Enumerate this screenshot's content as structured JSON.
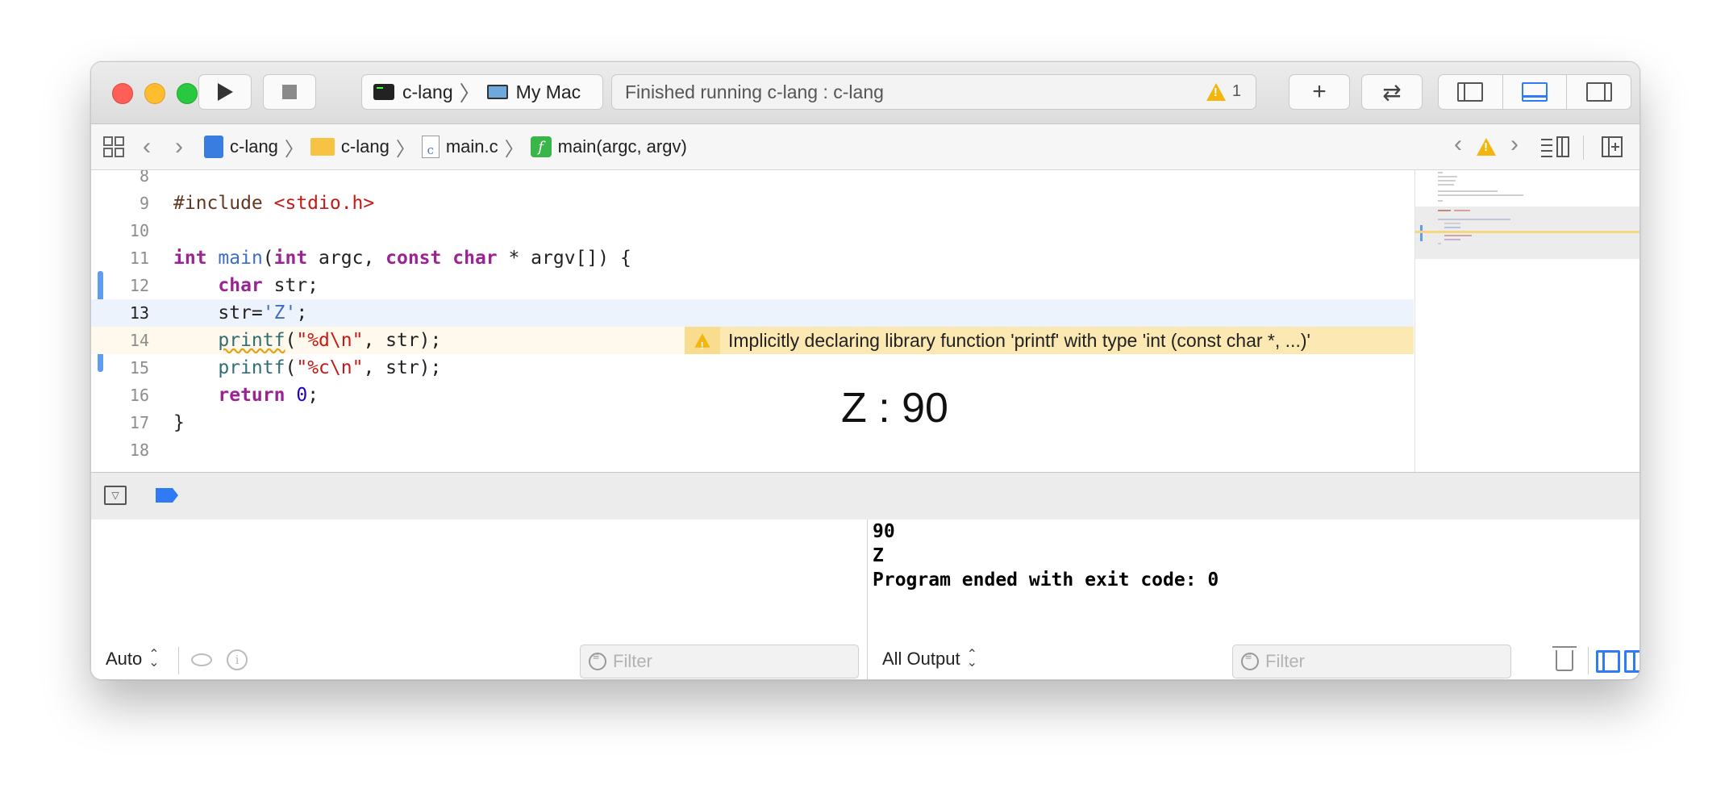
{
  "toolbar": {
    "scheme": "c-lang",
    "destination": "My Mac",
    "activity_status": "Finished running c-lang : c-lang",
    "warning_count": "1",
    "add_label": "+",
    "swap_label": "⇄"
  },
  "jumpbar": {
    "items": [
      "c-lang",
      "c-lang",
      "main.c",
      "main(argc, argv)"
    ]
  },
  "editor": {
    "lines": [
      {
        "num": "8"
      },
      {
        "num": "9"
      },
      {
        "num": "10"
      },
      {
        "num": "11"
      },
      {
        "num": "12"
      },
      {
        "num": "13"
      },
      {
        "num": "14"
      },
      {
        "num": "15"
      },
      {
        "num": "16"
      },
      {
        "num": "17"
      },
      {
        "num": "18"
      }
    ],
    "code": {
      "l9_pre": "#include ",
      "l9_hdr": "<stdio.h>",
      "l11_int": "int",
      "l11_main": "main",
      "l11_a": "(",
      "l11_int2": "int",
      "l11_b": " argc, ",
      "l11_const": "const",
      "l11_sp": " ",
      "l11_char": "char",
      "l11_c": " * argv[]) {",
      "l12_char": "char",
      "l12_rest": " str;",
      "l13_a": "str=",
      "l13_str": "'Z'",
      "l13_b": ";",
      "l14_fn": "printf",
      "l14_a": "(",
      "l14_str": "\"%d\\n\"",
      "l14_b": ", str);",
      "l15_fn": "printf",
      "l15_a": "(",
      "l15_str": "\"%c\\n\"",
      "l15_b": ", str);",
      "l16_ret": "return",
      "l16_sp": " ",
      "l16_num": "0",
      "l16_b": ";",
      "l17": "}"
    },
    "issue_message": "Implicitly declaring library function 'printf' with type 'int (const char *, ...)'",
    "overlay_result": "Z : 90"
  },
  "debug": {
    "variables_mode": "Auto",
    "filter_placeholder": "Filter",
    "console_mode": "All Output",
    "console_filter_placeholder": "Filter",
    "console_output": "90\nZ\nProgram ended with exit code: 0"
  },
  "colors": {
    "accent": "#2f7bf5",
    "warning": "#f5b50f",
    "issue_background": "#fbe8b2"
  }
}
